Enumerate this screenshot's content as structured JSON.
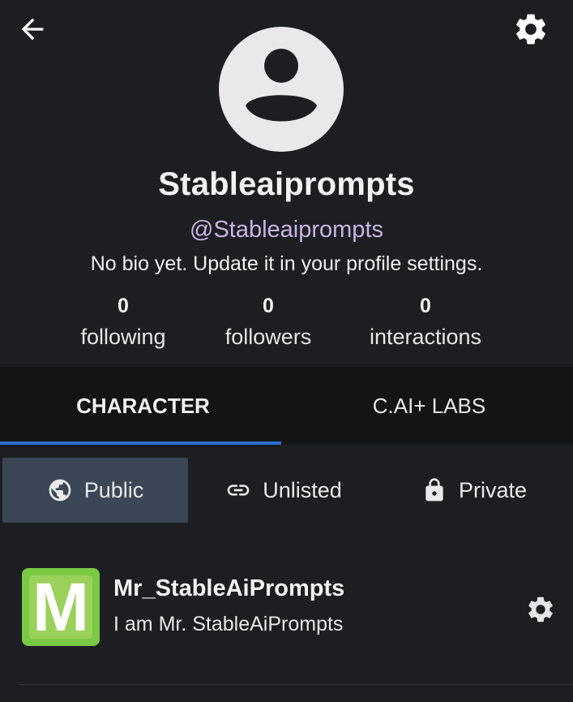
{
  "header": {
    "back_icon": "arrow-left-icon",
    "settings_icon": "gear-icon"
  },
  "profile": {
    "avatar_icon": "user-circle-icon",
    "name": "Stableaiprompts",
    "handle": "@Stableaiprompts",
    "bio": "No bio yet. Update it in your profile settings.",
    "stats": [
      {
        "value": "0",
        "label": "following"
      },
      {
        "value": "0",
        "label": "followers"
      },
      {
        "value": "0",
        "label": "interactions"
      }
    ]
  },
  "tabs": [
    {
      "label": "CHARACTER",
      "active": true
    },
    {
      "label": "C.AI+ LABS",
      "active": false
    }
  ],
  "filters": [
    {
      "label": "Public",
      "icon": "globe-icon",
      "active": true
    },
    {
      "label": "Unlisted",
      "icon": "link-icon",
      "active": false
    },
    {
      "label": "Private",
      "icon": "lock-icon",
      "active": false
    }
  ],
  "characters": [
    {
      "name": "Mr_StableAiPrompts",
      "description": "I am Mr. StableAiPrompts",
      "avatar_letter": "M",
      "settings_icon": "gear-icon"
    }
  ],
  "colors": {
    "background": "#1d1e21",
    "tab_bar": "#141416",
    "accent": "#2a6fd3",
    "handle": "#c7b3e6",
    "active_filter": "#3b4656",
    "character_avatar": "#7ac943"
  }
}
